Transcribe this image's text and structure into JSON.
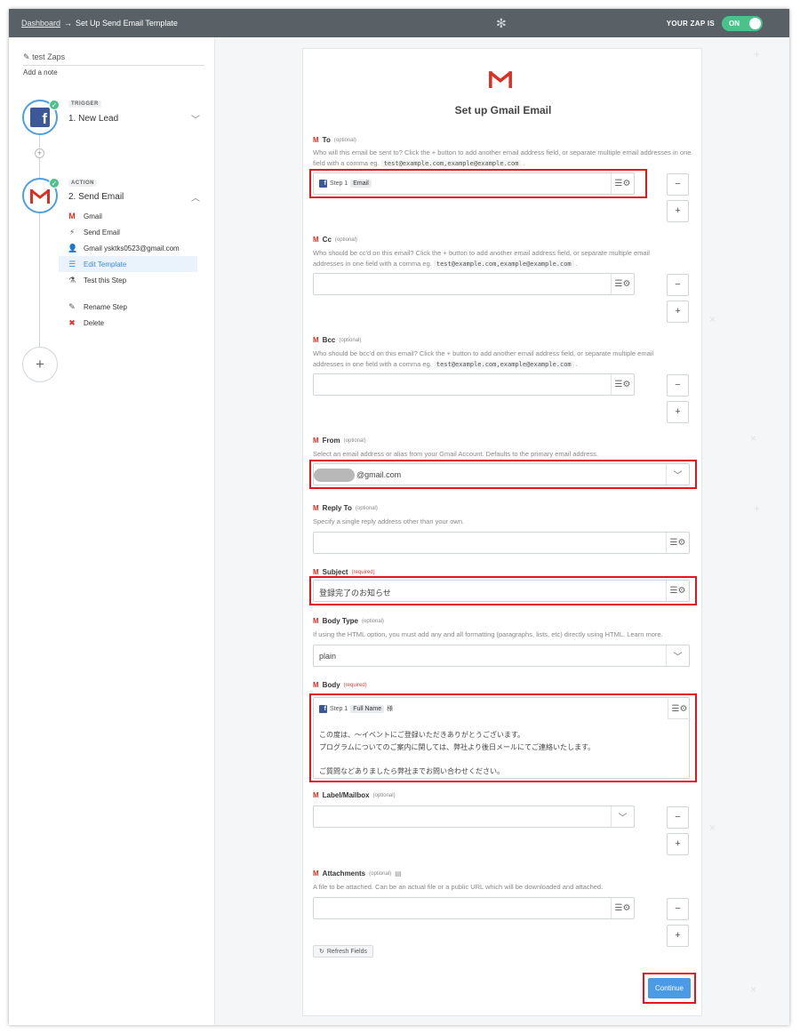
{
  "header": {
    "breadcrumb_link": "Dashboard",
    "breadcrumb_arrow": "→",
    "breadcrumb_current": "Set Up Send Email Template",
    "zap_status_label": "YOUR ZAP IS",
    "toggle_label": "ON"
  },
  "sidebar": {
    "zap_name": "test Zaps",
    "add_note": "Add a note",
    "trigger": {
      "badge": "TRIGGER",
      "title": "1. New Lead"
    },
    "action": {
      "badge": "ACTION",
      "title": "2. Send Email"
    },
    "subitems": [
      {
        "label": "Gmail"
      },
      {
        "label": "Send Email"
      },
      {
        "label": "Gmail ysktks0523@gmail.com"
      },
      {
        "label": "Edit Template"
      },
      {
        "label": "Test this Step"
      },
      {
        "label": "Rename Step"
      },
      {
        "label": "Delete"
      }
    ]
  },
  "form": {
    "title": "Set up Gmail Email",
    "optional": "(optional)",
    "required": "(required)",
    "to": {
      "label": "To",
      "help": "Who will this email be sent to? Click the + button to add another email address field, or separate multiple email addresses in one field with a comma eg.",
      "example": "test@example.com,example@example.com",
      "step": "Step 1",
      "tag": "Email"
    },
    "cc": {
      "label": "Cc",
      "help": "Who should be cc'd on this email? Click the + button to add another email address field, or separate multiple email addresses in one field with a comma eg.",
      "example": "test@example.com,example@example.com"
    },
    "bcc": {
      "label": "Bcc",
      "help": "Who should be bcc'd on this email? Click the + button to add another email address field, or separate multiple email addresses in one field with a comma eg.",
      "example": "test@example.com,example@example.com"
    },
    "from": {
      "label": "From",
      "help": "Select an email address or alias from your Gmail Account. Defaults to the primary email address.",
      "value": "@gmail.com"
    },
    "reply_to": {
      "label": "Reply To",
      "help": "Specify a single reply address other than your own."
    },
    "subject": {
      "label": "Subject",
      "value": "登録完了のお知らせ"
    },
    "body_type": {
      "label": "Body Type",
      "help": "If using the HTML option, you must add any and all formatting (paragraphs, lists, etc) directly using HTML. Learn more.",
      "value": "plain"
    },
    "body": {
      "label": "Body",
      "step": "Step 1",
      "tag": "Full Name",
      "suffix": "様",
      "line1": "この度は、～イベントにご登録いただきありがとうございます。",
      "line2": "プログラムについてのご案内に関しては、弊社より後日メールにてご連絡いたします。",
      "line3": "ご質問などありましたら弊社までお問い合わせください。"
    },
    "label_mailbox": {
      "label": "Label/Mailbox"
    },
    "attachments": {
      "label": "Attachments",
      "help": "A file to be attached. Can be an actual file or a public URL which will be downloaded and attached."
    },
    "refresh_label": "Refresh Fields",
    "continue_label": "Continue",
    "period": "."
  },
  "colors": {
    "highlight": "#e8141c",
    "toggle_on": "#4bc28c",
    "primary": "#4a9ae8"
  }
}
